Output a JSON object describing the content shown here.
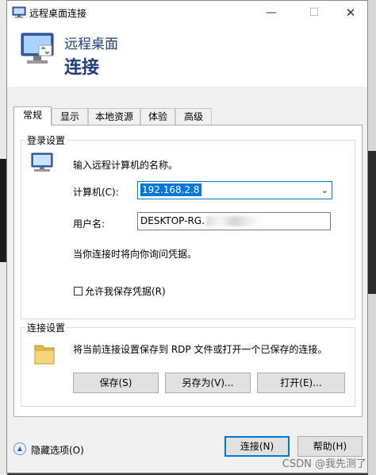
{
  "window": {
    "title": "远程桌面连接",
    "controls": {
      "minimize": "—",
      "maximize": "☐",
      "close": "✕"
    }
  },
  "header": {
    "line1": "远程桌面",
    "line2": "连接"
  },
  "tabs": [
    {
      "label": "常规",
      "active": true
    },
    {
      "label": "显示",
      "active": false
    },
    {
      "label": "本地资源",
      "active": false
    },
    {
      "label": "体验",
      "active": false
    },
    {
      "label": "高级",
      "active": false
    }
  ],
  "login": {
    "group_label": "登录设置",
    "prompt": "输入远程计算机的名称。",
    "computer_label": "计算机(C):",
    "computer_value": "192.168.2.8",
    "user_label": "用户名:",
    "user_value": "DESKTOP-RG.",
    "info": "当你连接时将向你询问凭据。",
    "save_creds_label": "允许我保存凭据(R)",
    "save_creds_checked": false
  },
  "conn": {
    "group_label": "连接设置",
    "desc": "将当前连接设置保存到 RDP 文件或打开一个已保存的连接。",
    "save": "保存(S)",
    "save_as": "另存为(V)...",
    "open": "打开(E)..."
  },
  "footer": {
    "hide_options": "隐藏选项(O)",
    "connect": "连接(N)",
    "help": "帮助(H)"
  },
  "watermark": "CSDN @我先测了",
  "colors": {
    "accent": "#0078d7",
    "header_text": "#1e3f78"
  }
}
